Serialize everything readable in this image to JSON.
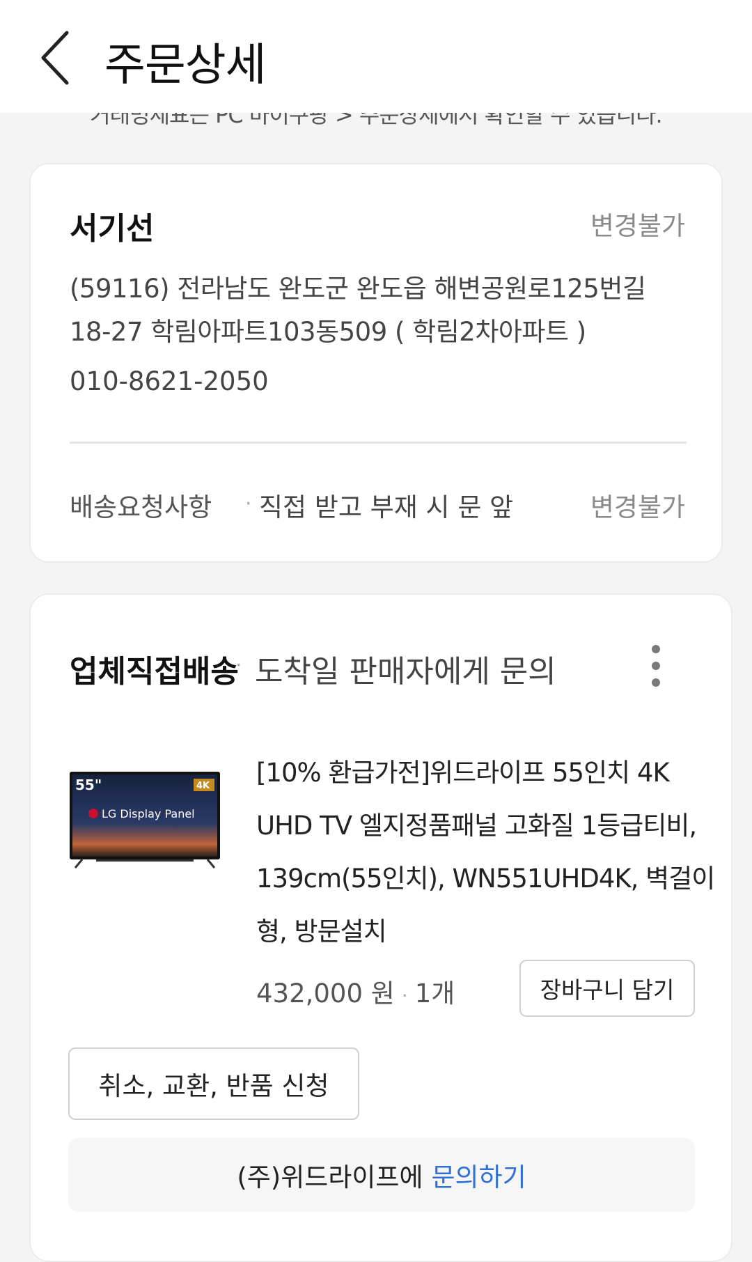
{
  "header": {
    "title": "주문상세"
  },
  "notice_text": "거래명세표는 PC 마이쿠팡 > 주문상세에서 확인할 수 있습니다.",
  "address_card": {
    "recipient": "서기선",
    "change_status": "변경불가",
    "address": "(59116) 전라남도 완도군 완도읍 해변공원로125번길 18-27 학림아파트103동509 ( 학림2차아파트 )",
    "phone": "010-8621-2050",
    "request_label": "배송요청사항",
    "request_value": "직접 받고 부재 시 문 앞",
    "request_change_status": "변경불가"
  },
  "order_card": {
    "shipping_type": "업체직접배송",
    "shipping_eta": "도착일 판매자에게 문의",
    "product": {
      "thumb_size": "55\"",
      "thumb_badge": "4K",
      "thumb_brand": "LG Display Panel",
      "name": "[10% 환급가전]위드라이프 55인치 4K UHD TV 엘지정품패널 고화질 1등급티비, 139cm(55인치), WN551UHD4K, 벽걸이형, 방문설치",
      "price": "432,000 원",
      "quantity": "1개"
    },
    "cart_button": "장바구니 담기",
    "cancel_button": "취소, 교환, 반품 신청",
    "inquiry_text": "(주)위드라이프에",
    "inquiry_link": "문의하기"
  },
  "colors": {
    "background": "#f4f4f4",
    "link": "#2f6fd6"
  }
}
